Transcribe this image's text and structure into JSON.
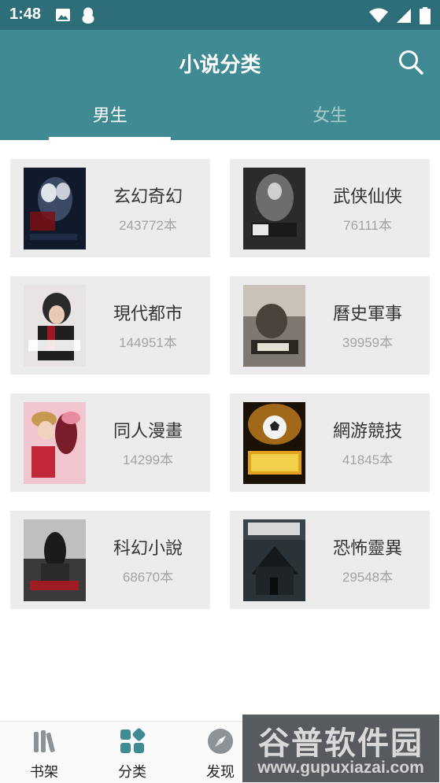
{
  "status_bar": {
    "time": "1:48",
    "left_icons": [
      "image-icon",
      "qq-penguin-icon"
    ],
    "right_icons": [
      "wifi-icon",
      "cellular-signal-icon",
      "battery-icon"
    ]
  },
  "header": {
    "title": "小说分类",
    "search_icon": "search-icon",
    "background_color": "#3f8a93"
  },
  "tabs": [
    {
      "label": "男生",
      "active": true
    },
    {
      "label": "女生",
      "active": false
    }
  ],
  "categories": [
    {
      "name": "玄幻奇幻",
      "count": "243772本"
    },
    {
      "name": "武侠仙侠",
      "count": "76111本"
    },
    {
      "name": "現代都市",
      "count": "144951本"
    },
    {
      "name": "曆史軍事",
      "count": "39959本"
    },
    {
      "name": "同人漫畫",
      "count": "14299本"
    },
    {
      "name": "網游競技",
      "count": "41845本"
    },
    {
      "name": "科幻小說",
      "count": "68670本"
    },
    {
      "name": "恐怖靈異",
      "count": "29548本"
    }
  ],
  "bottom_nav": [
    {
      "label": "书架",
      "icon": "bookshelf-icon",
      "active": false
    },
    {
      "label": "分类",
      "icon": "category-grid-icon",
      "active": true
    },
    {
      "label": "发现",
      "icon": "compass-icon",
      "active": false
    }
  ],
  "watermark": {
    "title": "谷普软件园",
    "url": "www.gupuxiazai.com"
  }
}
